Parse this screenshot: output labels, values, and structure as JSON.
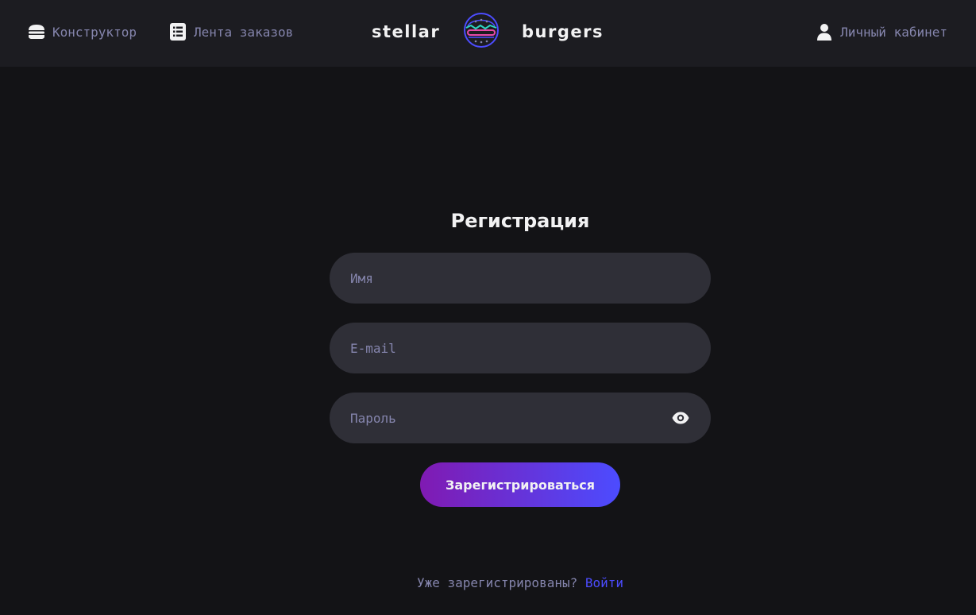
{
  "header": {
    "nav": {
      "constructor_label": "Конструктор",
      "feed_label": "Лента заказов",
      "account_label": "Личный кабинет"
    },
    "logo": {
      "left_word": "stellar",
      "right_word": "burgers",
      "icon": "burger-planet-icon"
    }
  },
  "form": {
    "title": "Регистрация",
    "name_placeholder": "Имя",
    "email_placeholder": "E-mail",
    "password_placeholder": "Пароль",
    "password_toggle_icon": "eye-icon",
    "submit_label": "Зарегистрироваться",
    "login_prompt": "Уже зарегистрированы?",
    "login_link": "Войти"
  },
  "colors": {
    "background": "#131316",
    "header_bg": "#1c1c21",
    "input_bg": "#2f2f37",
    "inactive_text": "#8585ad",
    "accent": "#4c4cff",
    "button_gradient_start": "#801ab2",
    "button_gradient_end": "#4c4cff"
  }
}
